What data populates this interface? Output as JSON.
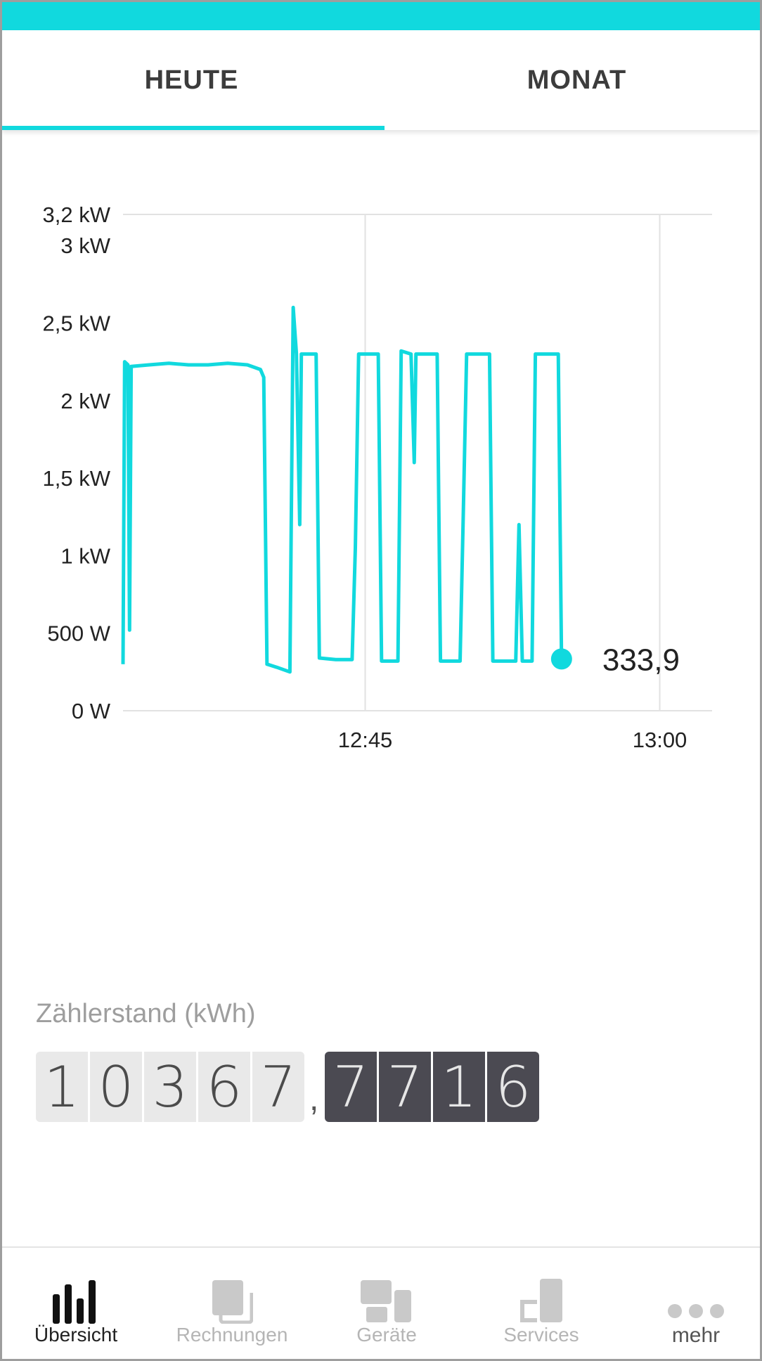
{
  "tabs": [
    {
      "label": "HEUTE",
      "active": true
    },
    {
      "label": "MONAT",
      "active": false
    }
  ],
  "accent_color": "#11d9de",
  "chart_data": {
    "type": "line",
    "y_ticks": [
      "3,2 kW",
      "3 kW",
      "2,5 kW",
      "2 kW",
      "1,5 kW",
      "1 kW",
      "500 W",
      "0 W"
    ],
    "y_tick_values": [
      3200,
      3000,
      2500,
      2000,
      1500,
      1000,
      500,
      0
    ],
    "x_ticks": [
      "12:45",
      "13:00"
    ],
    "x_tick_values": [
      "12:45",
      "13:00"
    ],
    "ylim": [
      0,
      3200
    ],
    "xlim": [
      "12:32:40",
      "13:02:40"
    ],
    "grid": true,
    "current_value_label": "333,9",
    "series": [
      {
        "color": "#11d9de",
        "points": [
          [
            "12:32:40",
            300
          ],
          [
            "12:32:45",
            2250
          ],
          [
            "12:32:55",
            2230
          ],
          [
            "12:33:00",
            520
          ],
          [
            "12:33:05",
            2220
          ],
          [
            "12:34:00",
            2230
          ],
          [
            "12:35:00",
            2240
          ],
          [
            "12:36:00",
            2230
          ],
          [
            "12:37:00",
            2230
          ],
          [
            "12:38:00",
            2240
          ],
          [
            "12:39:00",
            2230
          ],
          [
            "12:39:40",
            2200
          ],
          [
            "12:39:50",
            2150
          ],
          [
            "12:40:00",
            300
          ],
          [
            "12:40:30",
            280
          ],
          [
            "12:41:10",
            250
          ],
          [
            "12:41:20",
            2600
          ],
          [
            "12:41:30",
            2300
          ],
          [
            "12:41:40",
            1200
          ],
          [
            "12:41:45",
            2300
          ],
          [
            "12:42:30",
            2300
          ],
          [
            "12:42:40",
            340
          ],
          [
            "12:43:30",
            330
          ],
          [
            "12:44:20",
            330
          ],
          [
            "12:44:30",
            1050
          ],
          [
            "12:44:40",
            2300
          ],
          [
            "12:45:40",
            2300
          ],
          [
            "12:45:50",
            320
          ],
          [
            "12:46:40",
            320
          ],
          [
            "12:46:50",
            2320
          ],
          [
            "12:47:20",
            2300
          ],
          [
            "12:47:30",
            1600
          ],
          [
            "12:47:35",
            2300
          ],
          [
            "12:48:40",
            2300
          ],
          [
            "12:48:50",
            320
          ],
          [
            "12:49:50",
            320
          ],
          [
            "12:50:00",
            1300
          ],
          [
            "12:50:10",
            2300
          ],
          [
            "12:51:20",
            2300
          ],
          [
            "12:51:30",
            320
          ],
          [
            "12:52:40",
            320
          ],
          [
            "12:52:50",
            1200
          ],
          [
            "12:53:00",
            320
          ],
          [
            "12:53:30",
            320
          ],
          [
            "12:53:40",
            2300
          ],
          [
            "12:54:50",
            2300
          ],
          [
            "12:55:00",
            333.9
          ]
        ]
      }
    ]
  },
  "meter": {
    "label": "Zählerstand (kWh)",
    "integer_digits": [
      "1",
      "0",
      "3",
      "6",
      "7"
    ],
    "separator": ",",
    "decimal_digits": [
      "7",
      "7",
      "1",
      "6"
    ]
  },
  "nav": [
    {
      "label": "Übersicht",
      "icon": "bar-chart-icon",
      "active": true
    },
    {
      "label": "Rechnungen",
      "icon": "documents-icon",
      "active": false
    },
    {
      "label": "Geräte",
      "icon": "devices-icon",
      "active": false
    },
    {
      "label": "Services",
      "icon": "services-icon",
      "active": false
    },
    {
      "label": "mehr",
      "icon": "more-dots-icon",
      "active": false
    }
  ]
}
